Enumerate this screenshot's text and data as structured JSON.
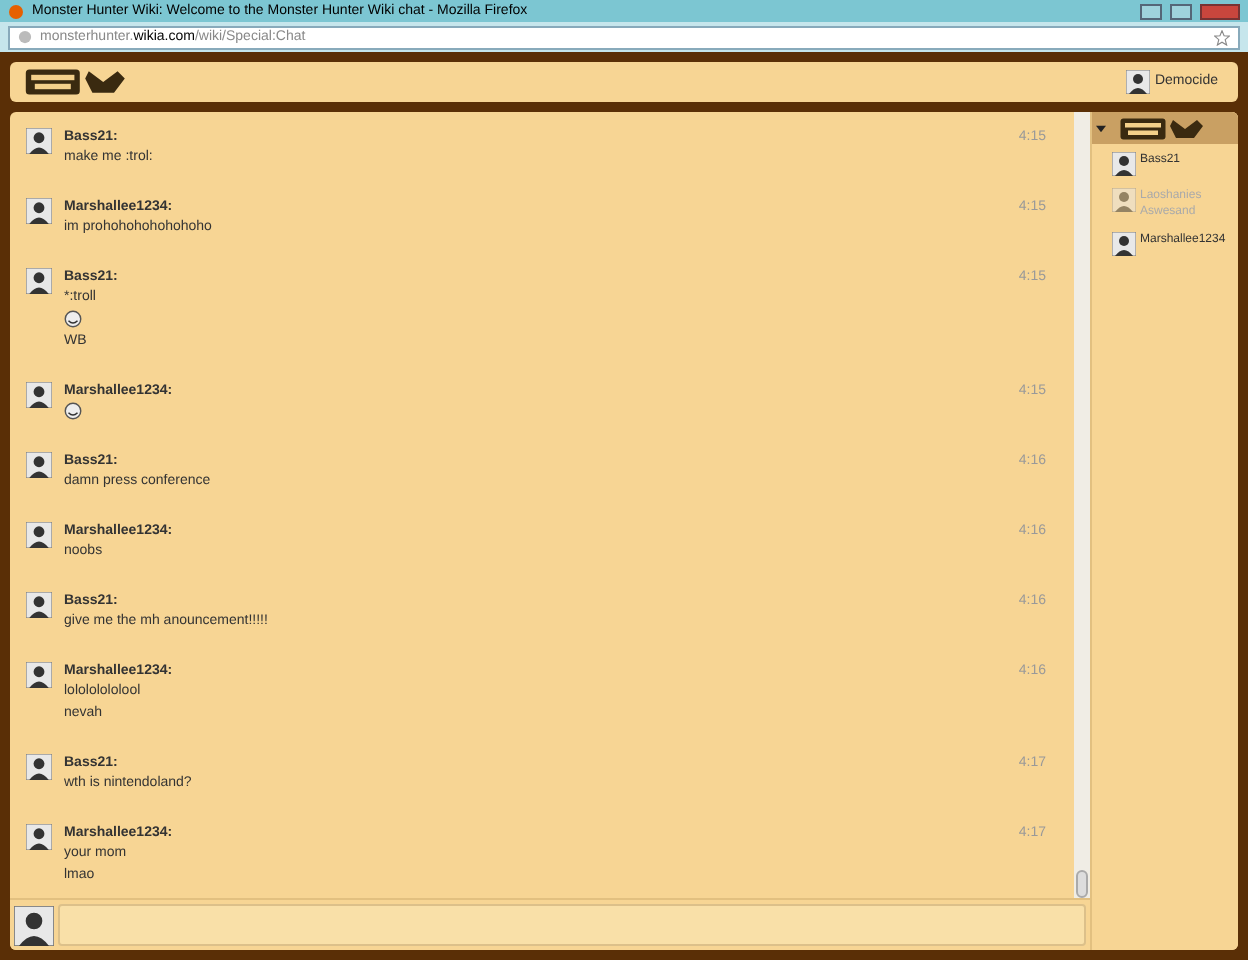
{
  "window": {
    "title": "Monster Hunter Wiki: Welcome to the Monster Hunter Wiki chat - Mozilla Firefox"
  },
  "address_bar": {
    "url_prefix": "monsterhunter.",
    "url_domain": "wikia.com",
    "url_path": "/wiki/Special:Chat"
  },
  "header": {
    "username": "Democide"
  },
  "messages": [
    {
      "user": "Bass21:",
      "time": "4:15",
      "lines": [
        {
          "kind": "text",
          "text": "make me :trol:"
        }
      ]
    },
    {
      "user": "Marshallee1234:",
      "time": "4:15",
      "lines": [
        {
          "kind": "text",
          "text": "im prohohohohohohoho"
        }
      ]
    },
    {
      "user": "Bass21:",
      "time": "4:15",
      "lines": [
        {
          "kind": "text",
          "text": "*:troll"
        },
        {
          "kind": "emoticon"
        },
        {
          "kind": "text",
          "text": "WB"
        }
      ]
    },
    {
      "user": "Marshallee1234:",
      "time": "4:15",
      "lines": [
        {
          "kind": "emoticon"
        }
      ]
    },
    {
      "user": "Bass21:",
      "time": "4:16",
      "lines": [
        {
          "kind": "text",
          "text": "damn press conference"
        }
      ]
    },
    {
      "user": "Marshallee1234:",
      "time": "4:16",
      "lines": [
        {
          "kind": "text",
          "text": "noobs"
        }
      ]
    },
    {
      "user": "Bass21:",
      "time": "4:16",
      "lines": [
        {
          "kind": "text",
          "text": "give me the mh anouncement!!!!!"
        }
      ]
    },
    {
      "user": "Marshallee1234:",
      "time": "4:16",
      "lines": [
        {
          "kind": "text",
          "text": "lolololololool"
        },
        {
          "kind": "text",
          "text": "nevah"
        }
      ]
    },
    {
      "user": "Bass21:",
      "time": "4:17",
      "lines": [
        {
          "kind": "text",
          "text": "wth is nintendoland?"
        }
      ]
    },
    {
      "user": "Marshallee1234:",
      "time": "4:17",
      "lines": [
        {
          "kind": "text",
          "text": "your mom"
        },
        {
          "kind": "text",
          "text": "lmao"
        }
      ]
    }
  ],
  "user_list": {
    "expanded": true,
    "users": [
      {
        "name": "Bass21",
        "away": false
      },
      {
        "name": "Laoshanies Aswesand",
        "away": true
      },
      {
        "name": "Marshallee1234",
        "away": false
      }
    ]
  }
}
